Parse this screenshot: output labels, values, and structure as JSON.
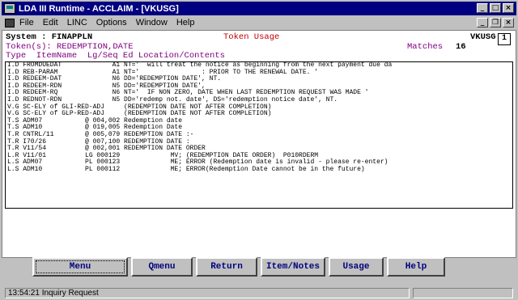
{
  "window": {
    "title": "LDA III Runtime - ACCLAIM - [VKUSG]",
    "controls": {
      "minimize": "_",
      "maximize": "□",
      "close": "×"
    }
  },
  "menubar": {
    "items": [
      "File",
      "Edit",
      "LINC",
      "Options",
      "Window",
      "Help"
    ],
    "mdi_controls": {
      "minimize": "_",
      "restore": "❐",
      "close": "×"
    }
  },
  "header": {
    "system_label": "System : FINAPPLN",
    "screen_title": "Token Usage",
    "screen_id": "VKUSG",
    "page_number": "1",
    "tokens_label": "Token(s): REDEMPTION,DATE",
    "matches_label": "Matches",
    "matches_value": "16",
    "columns_label": "Type  ItemName  Lg/Seq Ed Location/Contents"
  },
  "lines": [
    "I.D FROMDUEDAT             A1 NT='  will treat the notice as beginning from the next payment due da",
    "I.D REB-PARAM              A1 NT='                : PRIOR TO THE RENEWAL DATE. '",
    "I.D REDEEM-DAT             N6 DD='REDEMPTION DATE', NT.",
    "I.D REDEEM-RDN             N5 DD='REDEMPTION DATE',",
    "I.D REDEEM-RQ              N6 NT='  IF NON ZERO, DATE WHEN LAST REDEMPTION REQUEST WAS MADE '",
    "I.D REDNOT-RDN             N5 DD='redemp not. date', DS='redemption notice date', NT.",
    "V.G SC-ELY of GLI-RED-ADJ     (REDEMPTION DATE NOT AFTER COMPLETION)",
    "V.G SC-ELY of GLP-RED-ADJ     (REDEMPTION DATE NOT AFTER COMPLETION)",
    "T.S ADM07           @ 004,002 Redemption date",
    "T.S ADM10           @ 019,005 Redemption Date",
    "T.R CNTRL/11        @ 005,079 REDEMPTION DATE :-",
    "T.R I70/26          @ 007,100 REDEMPTION DATE :",
    "T.R V11/54          @ 002,001 REDEMPTION DATE ORDER",
    "L.R V11/01          LG 000129             MV; (REDEMPTION DATE ORDER)  P010RDERM",
    "L.S ADM07           PL 000123             ME; ERROR (Redemption date is invalid - please re-enter)",
    "L.S ADM10           PL 000112             ME; ERROR(Redemption Date cannot be in the future)"
  ],
  "buttons": [
    "Menu",
    "Qmenu",
    "Return",
    "Item/Notes",
    "Usage",
    "Help"
  ],
  "status": {
    "text": "13:54:21 Inquiry Request"
  }
}
